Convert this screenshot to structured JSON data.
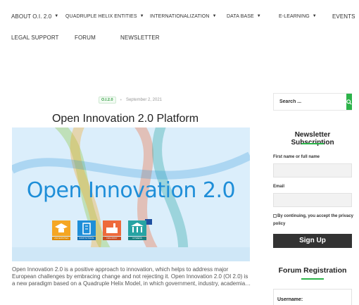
{
  "nav": {
    "row1": [
      {
        "label": "ABOUT O.I. 2.0",
        "caret": true
      },
      {
        "label": "QUADRUPLE HELIX ENTITIES",
        "caret": true
      },
      {
        "label": "INTERNATIONALIZATION",
        "caret": true
      },
      {
        "label": "DATA BASE",
        "caret": true
      },
      {
        "label": "E-LEARNING",
        "caret": true
      },
      {
        "label": "EVENTS",
        "caret": false
      }
    ],
    "row2": [
      {
        "label": "LEGAL SUPPORT"
      },
      {
        "label": "FORUM"
      },
      {
        "label": "NEWSLETTER"
      }
    ]
  },
  "post": {
    "category": "O.I.2.0",
    "date": "September 2, 2021",
    "title": "Open Innovation 2.0 Platform",
    "image_title": "Open Innovation 2.0",
    "helix_icons": [
      {
        "name": "university-icon",
        "label": "UNIVERSITIES",
        "color": "#f5a623"
      },
      {
        "name": "institution-icon",
        "label": "INSTITUTIONS",
        "color": "#1e8ed8"
      },
      {
        "name": "industry-icon",
        "label": "INDUSTRY",
        "color": "#ee6a3b"
      },
      {
        "name": "citizens-icon",
        "label": "CITIZENS",
        "color": "#27a3a3"
      }
    ],
    "excerpt": "Open Innovation 2.0 is a positive approach to innovation, which helps to address major European challenges by embracing change and not rejecting it. Open Innovation 2.0 (OI 2.0) is a new paradigm based on a Quadruple Helix Model, in which government, industry, academia…"
  },
  "sidebar": {
    "search_placeholder": "Search ...",
    "search_icon": "search-icon",
    "newsletter": {
      "title": "Newsletter Subscription",
      "name_label": "First name or full name",
      "email_label": "Email",
      "consent_text": "By continuing, you accept the privacy policy",
      "button_label": "Sign Up"
    },
    "forum": {
      "title": "Forum Registration",
      "username_label": "Username:"
    }
  },
  "colors": {
    "accent": "#2cb34a",
    "image_bg": "#dbeefb",
    "image_title": "#1e8ed8",
    "button_dark": "#333333"
  }
}
